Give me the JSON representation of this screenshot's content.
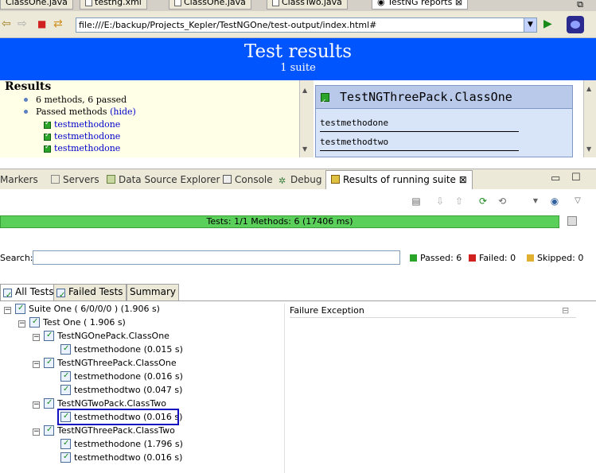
{
  "editor_tabs": [
    {
      "label": "ClassOne.java"
    },
    {
      "label": "testng.xml"
    },
    {
      "label": "ClassOne.java"
    },
    {
      "label": "ClassTwo.java"
    },
    {
      "label": "TestNG reports"
    }
  ],
  "browser": {
    "url": "file:///E:/backup/Projects_Kepler/TestNGOne/test-output/index.html#"
  },
  "report": {
    "title": "Test results",
    "subtitle": "1 suite",
    "results_heading": "Results",
    "summary": "6 methods, 6 passed",
    "passed_label": "Passed methods",
    "hide_link": "(hide)",
    "passed_methods": [
      "testmethodone",
      "testmethodone",
      "testmethodone"
    ],
    "class_panel": {
      "title": "TestNGThreePack.ClassOne",
      "methods": [
        "testmethodone",
        "testmethodtwo"
      ]
    }
  },
  "view_tabs": [
    {
      "label": "Markers"
    },
    {
      "label": "Servers"
    },
    {
      "label": "Data Source Explorer"
    },
    {
      "label": "Console"
    },
    {
      "label": "Debug"
    },
    {
      "label": "Results of running suite"
    }
  ],
  "progress": {
    "text": "Tests: 1/1  Methods: 6 (17406 ms)",
    "fraction": 1.0,
    "color": "#5ad05a"
  },
  "search": {
    "label": "Search:",
    "value": ""
  },
  "stats": {
    "passed": "Passed: 6",
    "failed": "Failed: 0",
    "skipped": "Skipped: 0"
  },
  "result_tabs": [
    {
      "label": "All Tests"
    },
    {
      "label": "Failed Tests"
    },
    {
      "label": "Summary"
    }
  ],
  "tree": {
    "suite": "Suite One  ( 6/0/0/0 ) (1.906 s)",
    "test": "Test One  ( 1.906 s)",
    "classes": [
      {
        "name": "TestNGOnePack.ClassOne",
        "methods": [
          "testmethodone  (0.015 s)"
        ]
      },
      {
        "name": "TestNGThreePack.ClassOne",
        "methods": [
          "testmethodone  (0.016 s)",
          "testmethodtwo  (0.047 s)"
        ]
      },
      {
        "name": "TestNGTwoPack.ClassTwo",
        "methods": [
          "testmethodtwo  (0.016 s)"
        ]
      },
      {
        "name": "TestNGThreePack.ClassTwo",
        "methods": [
          "testmethodone  (1.796 s)",
          "testmethodtwo  (0.016 s)"
        ]
      }
    ]
  },
  "failure_panel": {
    "title": "Failure Exception"
  }
}
